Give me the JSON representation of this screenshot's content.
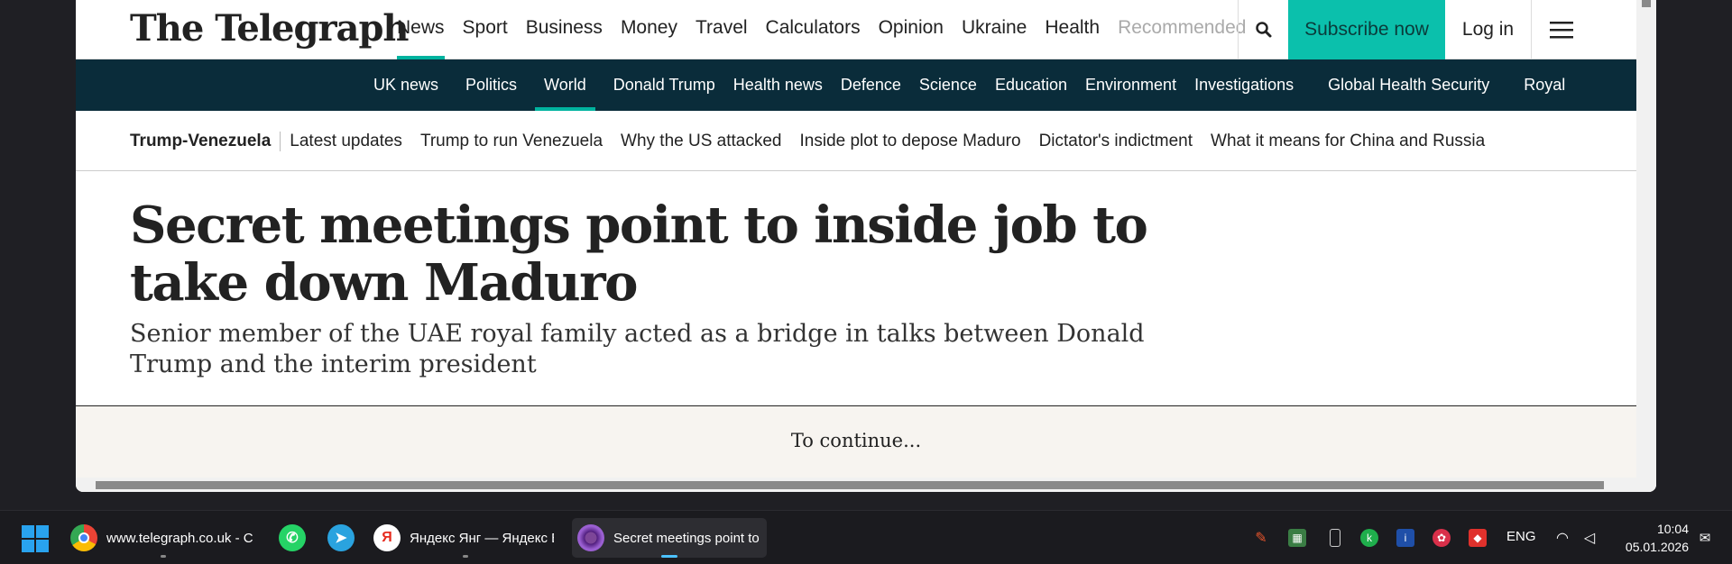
{
  "site": {
    "logo": "The Telegraph",
    "main_nav": [
      {
        "label": "News",
        "active": true
      },
      {
        "label": "Sport"
      },
      {
        "label": "Business"
      },
      {
        "label": "Money"
      },
      {
        "label": "Travel"
      },
      {
        "label": "Calculators"
      },
      {
        "label": "Opinion"
      },
      {
        "label": "Ukraine"
      },
      {
        "label": "Health"
      },
      {
        "label": "Recommended"
      }
    ],
    "subscribe_label": "Subscribe now",
    "login_label": "Log in",
    "sub_nav": [
      {
        "label": "UK news"
      },
      {
        "label": "Politics"
      },
      {
        "label": "World",
        "active": true
      },
      {
        "label": "Donald Trump"
      },
      {
        "label": "Health news"
      },
      {
        "label": "Defence"
      },
      {
        "label": "Science"
      },
      {
        "label": "Education"
      },
      {
        "label": "Environment"
      },
      {
        "label": "Investigations"
      },
      {
        "label": "Global Health Security"
      },
      {
        "label": "Royal"
      }
    ],
    "topic_lead": "Trump-Venezuela",
    "topic_links": [
      "Latest updates",
      "Trump to run Venezuela",
      "Why the US attacked",
      "Inside plot to depose Maduro",
      "Dictator's indictment",
      "What it means for China and Russia"
    ],
    "accent_color": "#00b39f",
    "subnav_bg": "#0a2c3a"
  },
  "article": {
    "headline": "Secret meetings point to inside job to take down Maduro",
    "standfirst": "Senior member of the UAE royal family acted as a bridge in talks between Donald Trump and the interim president",
    "continue_text": "To continue..."
  },
  "taskbar": {
    "apps": [
      {
        "name": "chrome",
        "label": "www.telegraph.co.uk - C"
      },
      {
        "name": "whatsapp",
        "label": ""
      },
      {
        "name": "telegram",
        "label": ""
      },
      {
        "name": "yandex",
        "label": "Яндекс Янг — Яндекс Б"
      },
      {
        "name": "tor",
        "label": "Secret meetings point to"
      }
    ],
    "lang": "ENG",
    "time": "10:04",
    "date": "05.01.2026"
  }
}
